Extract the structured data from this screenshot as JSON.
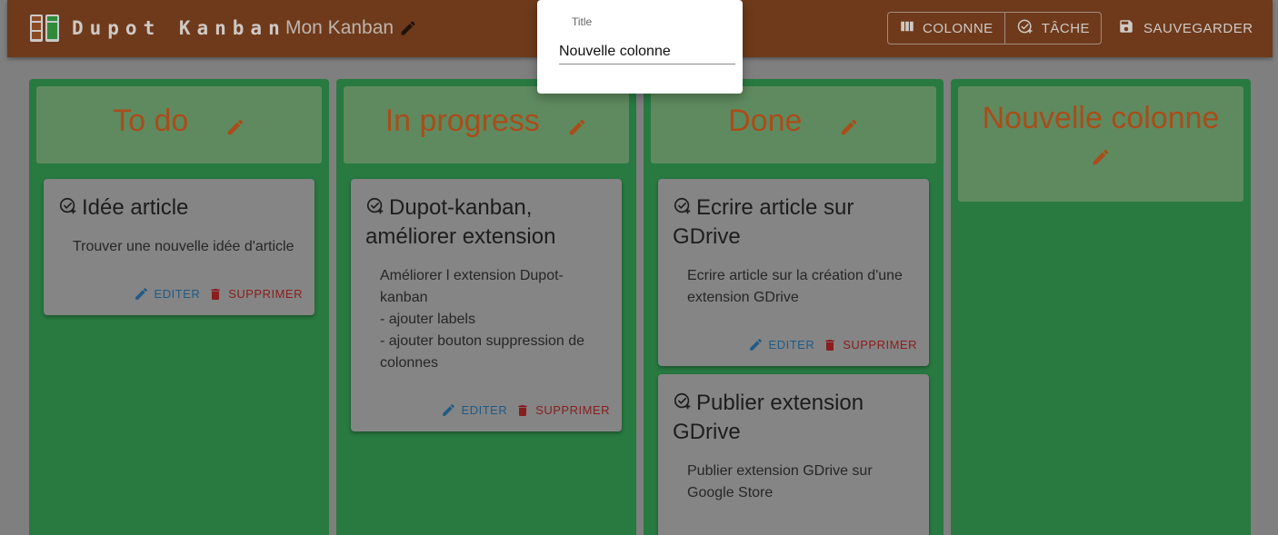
{
  "header": {
    "brand": "Dupot Kanban",
    "kanban_title": "Mon Kanban",
    "buttons": {
      "column_label": "COLONNE",
      "task_label": "TÂCHE",
      "save_label": "SAUVEGARDER"
    }
  },
  "dialog": {
    "label": "Title",
    "value": "Nouvelle colonne"
  },
  "columns": [
    {
      "title": "To do",
      "cards": [
        {
          "title": "Idée article",
          "description": "Trouver une nouvelle idée d'article",
          "edit_label": "EDITER",
          "delete_label": "SUPPRIMER"
        }
      ]
    },
    {
      "title": "In progress",
      "cards": [
        {
          "title": "Dupot-kanban, améliorer extension",
          "description": "Améliorer l extension Dupot-kanban\n- ajouter labels\n- ajouter bouton suppression de colonnes",
          "edit_label": "EDITER",
          "delete_label": "SUPPRIMER"
        }
      ]
    },
    {
      "title": "Done",
      "cards": [
        {
          "title": "Ecrire article sur GDrive",
          "description": "Ecrire article sur la création d'une extension GDrive",
          "edit_label": "EDITER",
          "delete_label": "SUPPRIMER"
        },
        {
          "title": "Publier extension GDrive",
          "description": "Publier extension GDrive sur Google Store"
        }
      ]
    },
    {
      "title": "Nouvelle colonne",
      "cards": []
    }
  ],
  "colors": {
    "appbar": "#6e3a1b",
    "column": "#287a41",
    "column_title": "#a94d1a",
    "edit_action": "#1f5b86",
    "delete_action": "#8a1d1d"
  }
}
